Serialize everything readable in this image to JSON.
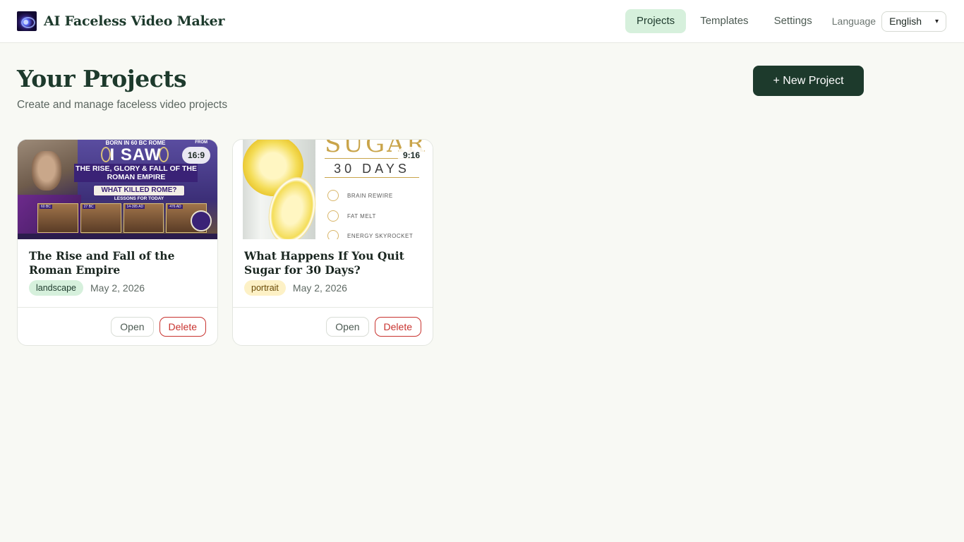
{
  "app": {
    "title": "AI Faceless Video Maker"
  },
  "nav": {
    "items": [
      {
        "label": "Projects",
        "active": true
      },
      {
        "label": "Templates",
        "active": false
      },
      {
        "label": "Settings",
        "active": false
      }
    ],
    "language_label": "Language",
    "language_value": "English"
  },
  "page": {
    "title": "Your Projects",
    "subtitle": "Create and manage faceless video projects",
    "new_button": "+ New Project"
  },
  "projects": [
    {
      "title": "The Rise and Fall of the Roman Empire",
      "orientation": "landscape",
      "aspect_ratio": "16:9",
      "date": "May 2, 2026",
      "open_label": "Open",
      "delete_label": "Delete",
      "thumbnail_text": {
        "top": "BORN IN 60 BC ROME",
        "from": "FROM",
        "headline": "I SAW",
        "band": "THE RISE, GLORY & FALL OF THE ROMAN EMPIRE",
        "question": "WHAT KILLED ROME?",
        "lessons": "LESSONS FOR TODAY",
        "panels": [
          "60 BC",
          "27 BC",
          "14-395 AD",
          "476 AD"
        ]
      }
    },
    {
      "title": "What Happens If You Quit Sugar for 30 Days?",
      "orientation": "portrait",
      "aspect_ratio": "9:16",
      "date": "May 2, 2026",
      "open_label": "Open",
      "delete_label": "Delete",
      "thumbnail_text": {
        "headline": "SUGAR",
        "sub": "30 DAYS",
        "items": [
          "BRAIN REWIRE",
          "FAT MELT",
          "ENERGY SKYROCKET"
        ]
      }
    }
  ],
  "colors": {
    "accent": "#1d3a2c",
    "active_nav_bg": "#d6f0dc",
    "delete": "#c8332f",
    "portrait_tag": "#fdf1c6"
  }
}
